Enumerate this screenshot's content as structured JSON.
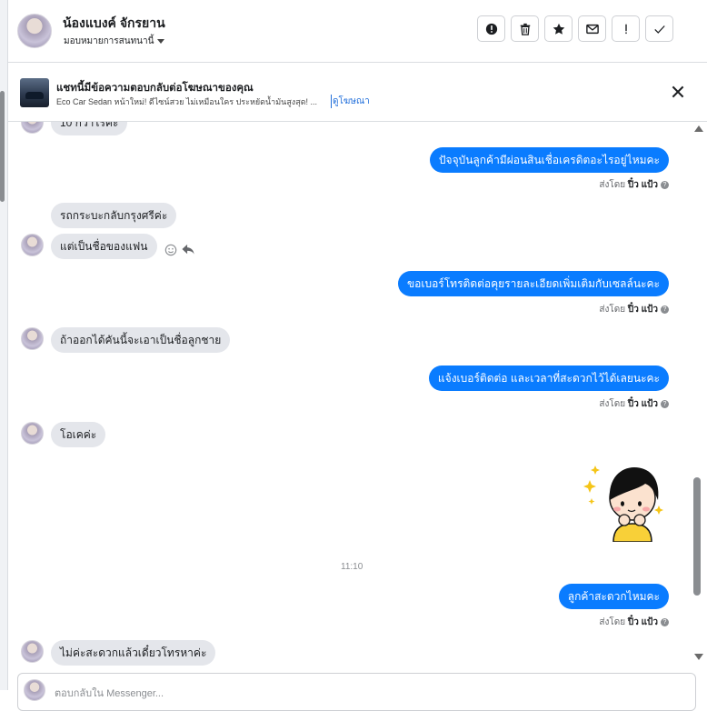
{
  "header": {
    "contact_name": "น้องแบงค์ จักรยาน",
    "assign_label": "มอบหมายการสนทนานี้",
    "action_icons": [
      "alert-circle-icon",
      "trash-icon",
      "star-icon",
      "envelope-icon",
      "exclamation-icon",
      "check-icon"
    ]
  },
  "ad_banner": {
    "title": "แชทนี้มีข้อความตอบกลับต่อโฆษณาของคุณ",
    "description": "Eco Car Sedan หน้าใหม่! ดีไซน์สวย ไม่เหมือนใคร ประหยัดน้ำมันสูงสุด! ...",
    "link": "ดูโฆษณา"
  },
  "messages": {
    "m0": "10 กว่าไรคะ",
    "m1": "ปัจจุบันลูกค้ามีผ่อนสินเชื่อเครดิตอะไรอยู่ไหมคะ",
    "m2": "รถกระบะกลับกรุงศรีค่ะ",
    "m3": "แต่เป็นชื่อของแฟน",
    "m4": "ขอเบอร์โทรติดต่อคุยรายละเอียดเพิ่มเติมกับเซลล์นะคะ",
    "m5": "ถ้าออกได้คันนี้จะเอาเป็นชื่อลูกชาย",
    "m6": "แจ้งเบอร์ติดต่อ  และเวลาที่สะดวกไว้ได้เลยนะคะ",
    "m7": "โอเคค่ะ",
    "m8": "ลูกค้าสะดวกไหมคะ",
    "m9": "ไม่ค่ะสะดวกแล้วเดี๋ยวโทรหาค่ะ"
  },
  "sent_by": {
    "prefix": "ส่งโดย",
    "name": "ปิ๋ว แป้ว"
  },
  "timestamp": "11:10",
  "composer": {
    "placeholder": "ตอบกลับใน Messenger..."
  },
  "colors": {
    "outgoing_bubble": "#0a7cff",
    "incoming_bubble": "#e4e6eb",
    "link": "#216fdb"
  }
}
